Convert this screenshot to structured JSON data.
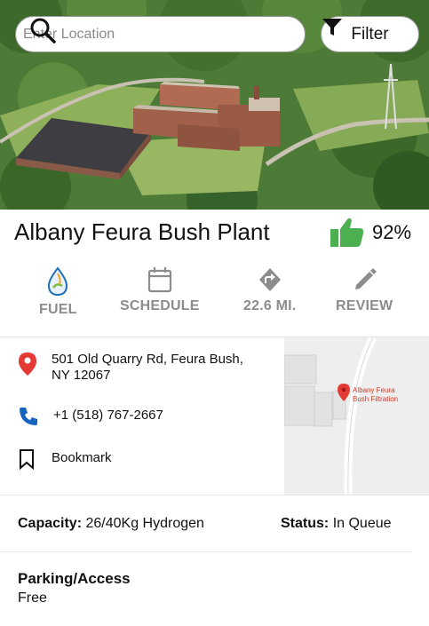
{
  "search": {
    "placeholder": "Enter Location"
  },
  "filter": {
    "label": "Filter"
  },
  "station": {
    "name": "Albany Feura Bush Plant",
    "rating": "92%"
  },
  "actions": [
    {
      "label": "FUEL",
      "icon": "fuel-drop-icon"
    },
    {
      "label": "SCHEDULE",
      "icon": "calendar-icon"
    },
    {
      "label": "22.6 MI.",
      "icon": "directions-icon"
    },
    {
      "label": "REVIEW",
      "icon": "pencil-icon"
    }
  ],
  "info": {
    "address_line1": "501 Old Quarry Rd, Feura Bush,",
    "address_line2": "NY 12067",
    "phone": "+1 (518) 767-2667",
    "bookmark": "Bookmark"
  },
  "map": {
    "label_line1": "Albany Feura",
    "label_line2": "Bush Filtration"
  },
  "details": {
    "capacity_label": "Capacity:",
    "capacity_value": "26/40Kg Hydrogen",
    "status_label": "Status:",
    "status_value": "In Queue",
    "parking_title": "Parking/Access",
    "parking_value": "Free"
  },
  "colors": {
    "accent_green": "#4caf50",
    "pin_red": "#e53935",
    "phone_blue": "#1565c0",
    "label_gray": "#8c8c8c"
  }
}
